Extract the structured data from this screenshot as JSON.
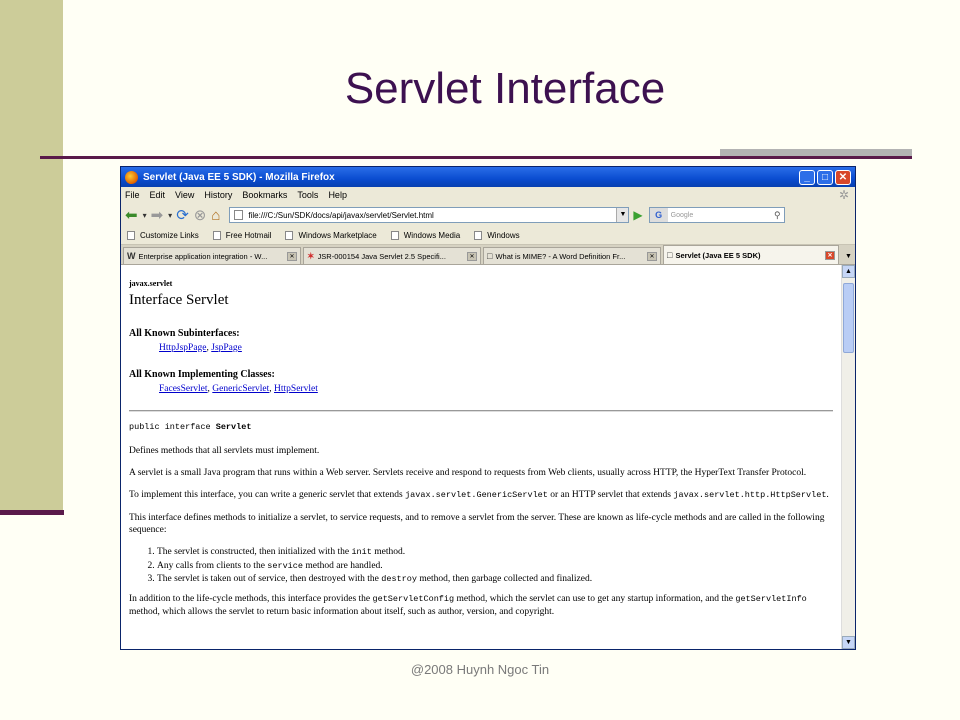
{
  "slide": {
    "title": "Servlet Interface",
    "footer": "@2008 Huynh Ngoc Tin"
  },
  "browser": {
    "window_title": "Servlet (Java EE 5 SDK) - Mozilla Firefox",
    "menu": [
      "File",
      "Edit",
      "View",
      "History",
      "Bookmarks",
      "Tools",
      "Help"
    ],
    "url": "file:///C:/Sun/SDK/docs/api/javax/servlet/Servlet.html",
    "search_placeholder": "Google",
    "bookmarks": [
      "Customize Links",
      "Free Hotmail",
      "Windows Marketplace",
      "Windows Media",
      "Windows"
    ],
    "tabs": [
      {
        "favicon": "W",
        "label": "Enterprise application integration - W..."
      },
      {
        "favicon": "✶",
        "label": "JSR-000154 Java Servlet 2.5 Specifi..."
      },
      {
        "favicon": "□",
        "label": "What is MIME? - A Word Definition Fr..."
      },
      {
        "favicon": "□",
        "label": "Servlet (Java EE 5 SDK)"
      }
    ],
    "active_tab_index": 3
  },
  "doc": {
    "package": "javax.servlet",
    "title": "Interface Servlet",
    "subinterfaces_label": "All Known Subinterfaces:",
    "subinterfaces": [
      "HttpJspPage",
      "JspPage"
    ],
    "implementing_label": "All Known Implementing Classes:",
    "implementing": [
      "FacesServlet",
      "GenericServlet",
      "HttpServlet"
    ],
    "decl_prefix": "public interface ",
    "decl_name": "Servlet",
    "p1": "Defines methods that all servlets must implement.",
    "p2": "A servlet is a small Java program that runs within a Web server. Servlets receive and respond to requests from Web clients, usually across HTTP, the HyperText Transfer Protocol.",
    "p3_a": "To implement this interface, you can write a generic servlet that extends ",
    "p3_code1": "javax.servlet.GenericServlet",
    "p3_b": " or an HTTP servlet that extends ",
    "p3_code2": "javax.servlet.http.HttpServlet",
    "p3_c": ".",
    "p4": "This interface defines methods to initialize a servlet, to service requests, and to remove a servlet from the server. These are known as life-cycle methods and are called in the following sequence:",
    "li1_a": "The servlet is constructed, then initialized with the ",
    "li1_code": "init",
    "li1_b": " method.",
    "li2_a": "Any calls from clients to the ",
    "li2_code": "service",
    "li2_b": " method are handled.",
    "li3_a": "The servlet is taken out of service, then destroyed with the ",
    "li3_code": "destroy",
    "li3_b": " method, then garbage collected and finalized.",
    "p5_a": "In addition to the life-cycle methods, this interface provides the ",
    "p5_code1": "getServletConfig",
    "p5_b": " method, which the servlet can use to get any startup information, and the ",
    "p5_code2": "getServletInfo",
    "p5_c": " method, which allows the servlet to return basic information about itself, such as author, version, and copyright."
  }
}
